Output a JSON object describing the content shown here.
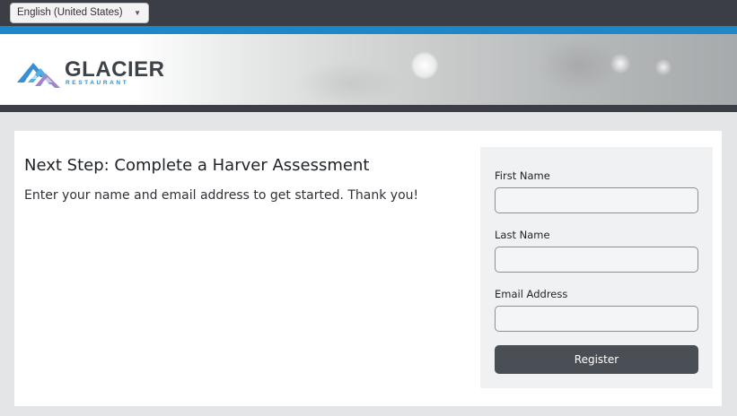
{
  "language_select": {
    "selected": "English (United States)",
    "caret_icon": "caret-down-icon"
  },
  "logo": {
    "name": "GLACIER",
    "subtitle": "RESTAURANT"
  },
  "colors": {
    "accent_blue": "#1c88c9",
    "dark_bar": "#3b3f45",
    "button": "#4a4f56"
  },
  "main": {
    "heading": "Next Step: Complete a Harver Assessment",
    "subtext": "Enter your name and email address to get started. Thank you!"
  },
  "form": {
    "first_name_label": "First Name",
    "first_name_value": "",
    "last_name_label": "Last Name",
    "last_name_value": "",
    "email_label": "Email Address",
    "email_value": "",
    "register_label": "Register"
  }
}
